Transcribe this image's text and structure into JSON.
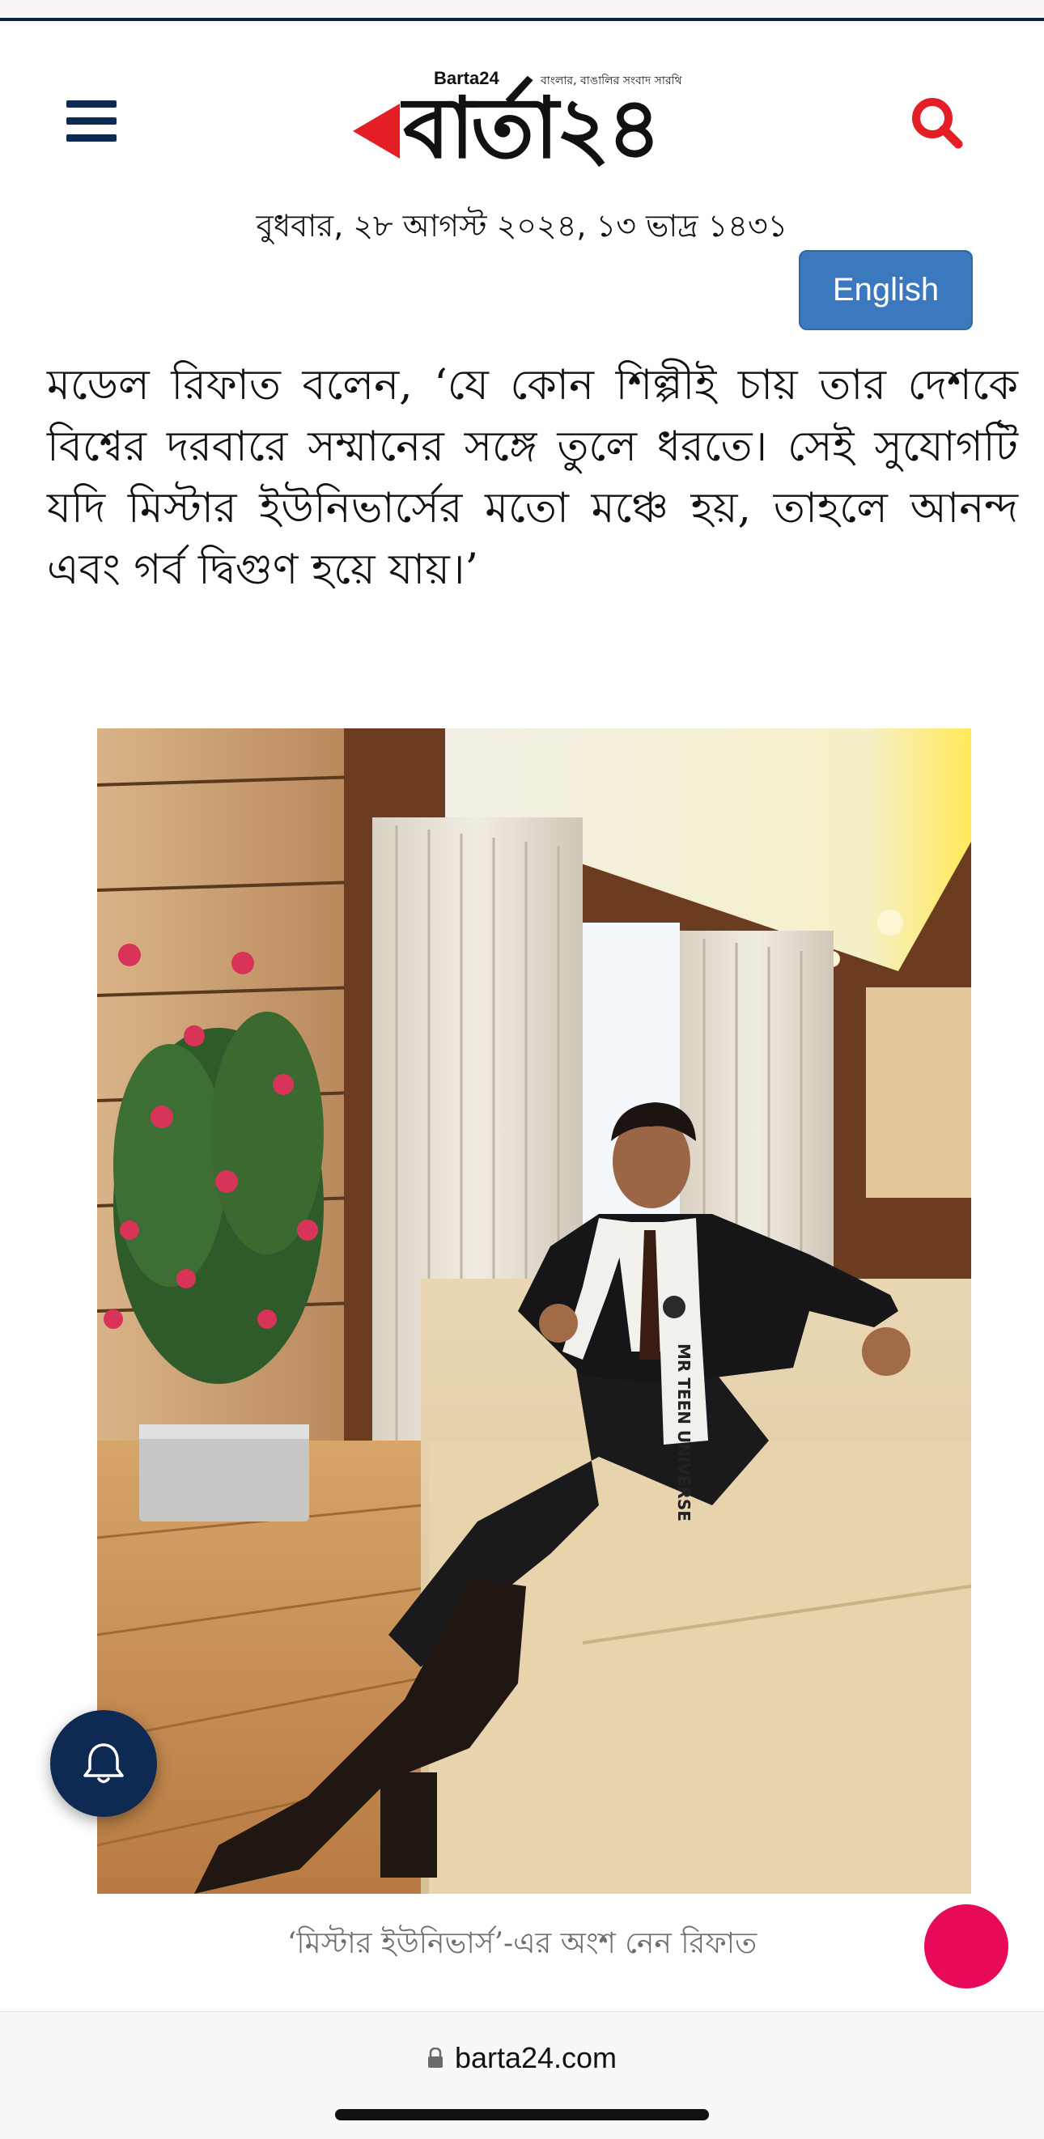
{
  "header": {
    "logo_small_en": "Barta24",
    "logo_tagline": "বাংলার, বাঙালির সংবাদ সারথি",
    "logo_main": "বার্তা২৪",
    "date": "বুধবার, ২৮ আগস্ট ২০২৪, ১৩ ভাদ্র ১৪৩১",
    "language_button": "English",
    "menu_icon": "hamburger-menu-icon",
    "search_icon": "search-icon"
  },
  "article": {
    "paragraph": "মডেল রিফাত বলেন, ‘যে কোন শিল্পীই চায় তার দেশকে বিশ্বের দরবারে সম্মানের সঙ্গে তুলে ধরতে। সেই সুযোগটি যদি মিস্টার ইউনিভার্সের মতো মঞ্চে হয়, তাহলে আনন্দ এবং গর্ব দ্বিগুণ হয়ে যায়।’",
    "image_caption": "‘মিস্টার ইউনিভার্স’-এর অংশ নেন রিফাত",
    "sash_text": "MR TEEN UNIVERSE"
  },
  "floating": {
    "bell_icon": "notification-bell-icon"
  },
  "browser": {
    "url": "barta24.com",
    "lock_icon": "lock-icon"
  },
  "colors": {
    "brand_navy": "#0f2a52",
    "brand_red": "#e31e24",
    "button_blue": "#3b78be",
    "accent_pink": "#e9095a"
  }
}
